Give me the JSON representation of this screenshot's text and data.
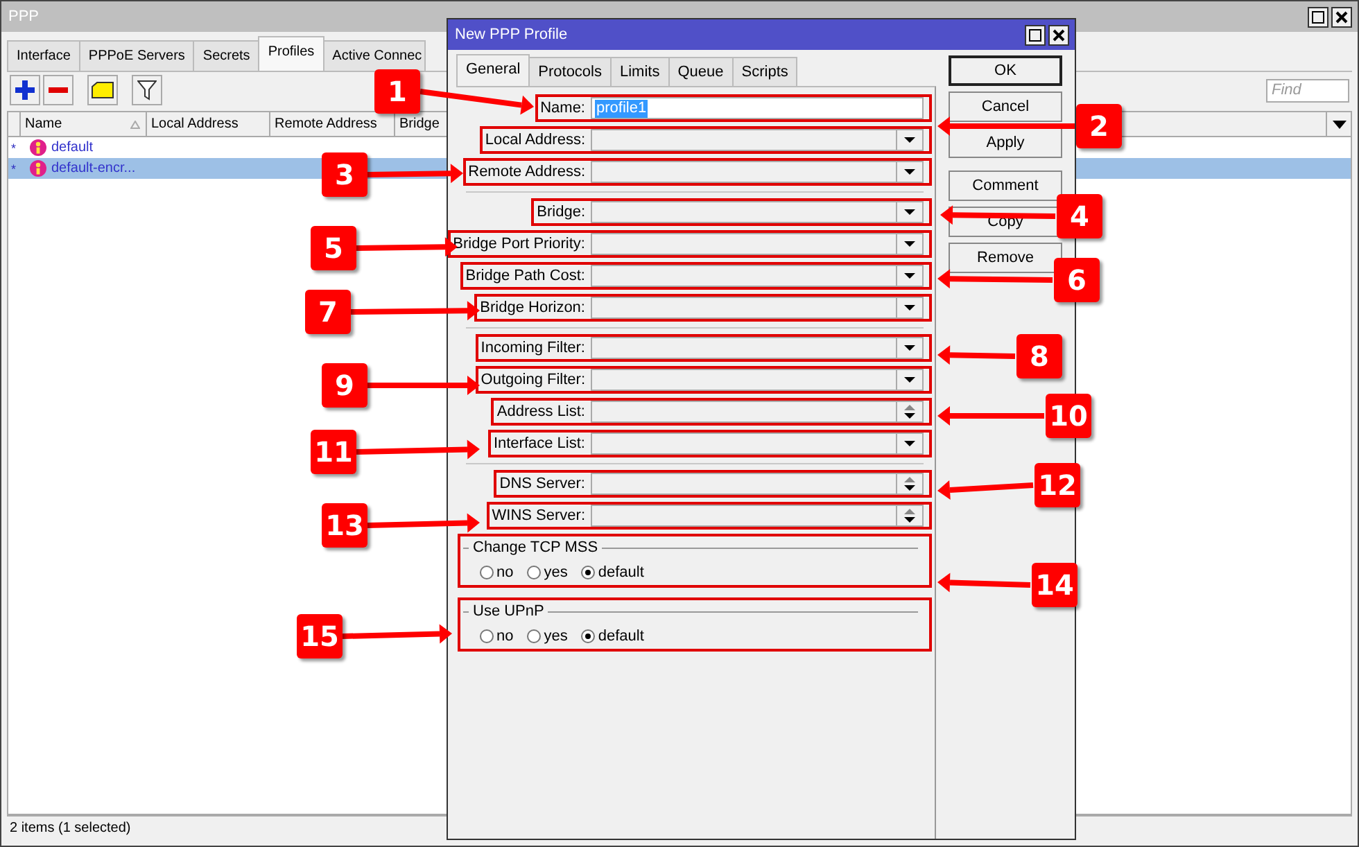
{
  "ppp_window": {
    "title": "PPP",
    "tabs": [
      {
        "label": "Interface",
        "selected": false
      },
      {
        "label": "PPPoE Servers",
        "selected": false
      },
      {
        "label": "Secrets",
        "selected": false
      },
      {
        "label": "Profiles",
        "selected": true
      },
      {
        "label": "Active Connec",
        "selected": false
      }
    ],
    "find_placeholder": "Find",
    "table": {
      "columns": [
        "Name",
        "Local Address",
        "Remote Address",
        "Bridge"
      ],
      "rows": [
        {
          "marker": "*",
          "name": "default",
          "selected": false
        },
        {
          "marker": "*",
          "name": "default-encr...",
          "selected": true
        }
      ]
    },
    "status_bar": "2 items (1 selected)"
  },
  "dialog": {
    "title": "New PPP Profile",
    "tabs": [
      {
        "label": "General",
        "selected": true
      },
      {
        "label": "Protocols",
        "selected": false
      },
      {
        "label": "Limits",
        "selected": false
      },
      {
        "label": "Queue",
        "selected": false
      },
      {
        "label": "Scripts",
        "selected": false
      }
    ],
    "sections": [
      {
        "fields": [
          {
            "label": "Name:",
            "kind": "text",
            "value": "profile1",
            "value_selected": true
          },
          {
            "label": "Local Address:",
            "kind": "dropdown"
          },
          {
            "label": "Remote Address:",
            "kind": "dropdown"
          }
        ]
      },
      {
        "fields": [
          {
            "label": "Bridge:",
            "kind": "dropdown"
          },
          {
            "label": "Bridge Port Priority:",
            "kind": "dropdown"
          },
          {
            "label": "Bridge Path Cost:",
            "kind": "dropdown"
          },
          {
            "label": "Bridge Horizon:",
            "kind": "dropdown"
          }
        ]
      },
      {
        "fields": [
          {
            "label": "Incoming Filter:",
            "kind": "dropdown"
          },
          {
            "label": "Outgoing Filter:",
            "kind": "dropdown"
          },
          {
            "label": "Address List:",
            "kind": "spinner"
          },
          {
            "label": "Interface List:",
            "kind": "dropdown"
          }
        ]
      },
      {
        "fields": [
          {
            "label": "DNS Server:",
            "kind": "spinner"
          },
          {
            "label": "WINS Server:",
            "kind": "spinner"
          }
        ]
      }
    ],
    "radio_groups": [
      {
        "title": "Change TCP MSS",
        "options": [
          {
            "label": "no",
            "selected": false
          },
          {
            "label": "yes",
            "selected": false
          },
          {
            "label": "default",
            "selected": true
          }
        ]
      },
      {
        "title": "Use UPnP",
        "options": [
          {
            "label": "no",
            "selected": false
          },
          {
            "label": "yes",
            "selected": false
          },
          {
            "label": "default",
            "selected": true
          }
        ]
      }
    ],
    "buttons": [
      {
        "label": "OK",
        "default": true
      },
      {
        "label": "Cancel",
        "default": false
      },
      {
        "label": "Apply",
        "default": false
      },
      {
        "label": "Comment",
        "default": false
      },
      {
        "label": "Copy",
        "default": false
      },
      {
        "label": "Remove",
        "default": false
      }
    ]
  },
  "callouts": [
    {
      "label": "1"
    },
    {
      "label": "2"
    },
    {
      "label": "3"
    },
    {
      "label": "4"
    },
    {
      "label": "5"
    },
    {
      "label": "6"
    },
    {
      "label": "7"
    },
    {
      "label": "8"
    },
    {
      "label": "9"
    },
    {
      "label": "10"
    },
    {
      "label": "11"
    },
    {
      "label": "12"
    },
    {
      "label": "13"
    },
    {
      "label": "14"
    },
    {
      "label": "15"
    }
  ]
}
